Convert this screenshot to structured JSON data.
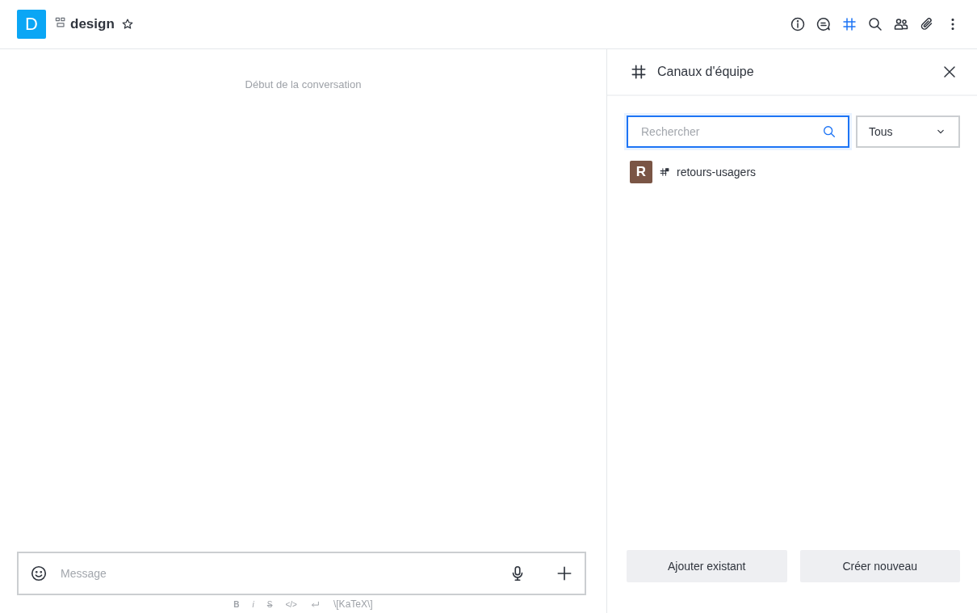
{
  "room": {
    "avatar_letter": "D",
    "name": "design",
    "favorite": false
  },
  "header_actions": [
    {
      "kind": "info",
      "selected": false
    },
    {
      "kind": "discussion",
      "selected": false
    },
    {
      "kind": "channels",
      "selected": true
    },
    {
      "kind": "search",
      "selected": false
    },
    {
      "kind": "members",
      "selected": false
    },
    {
      "kind": "files",
      "selected": false
    },
    {
      "kind": "more",
      "selected": false
    }
  ],
  "conversation": {
    "start_label": "Début de la conversation"
  },
  "composer": {
    "placeholder": "Message"
  },
  "format_tools": [
    {
      "kind": "bold",
      "label": "B"
    },
    {
      "kind": "italic",
      "label": "i"
    },
    {
      "kind": "strike",
      "label": "S"
    },
    {
      "kind": "code",
      "label": "</>"
    },
    {
      "kind": "newline"
    },
    {
      "kind": "katex",
      "label": "\\[KaTeX\\]"
    }
  ],
  "panel": {
    "title": "Canaux d'équipe",
    "search": {
      "placeholder": "Rechercher"
    },
    "filter": {
      "value": "Tous"
    },
    "channels": [
      {
        "avatar_letter": "R",
        "color": "#7a5545",
        "name": "retours-usagers"
      }
    ],
    "buttons": [
      "Ajouter existant",
      "Créer nouveau"
    ]
  }
}
